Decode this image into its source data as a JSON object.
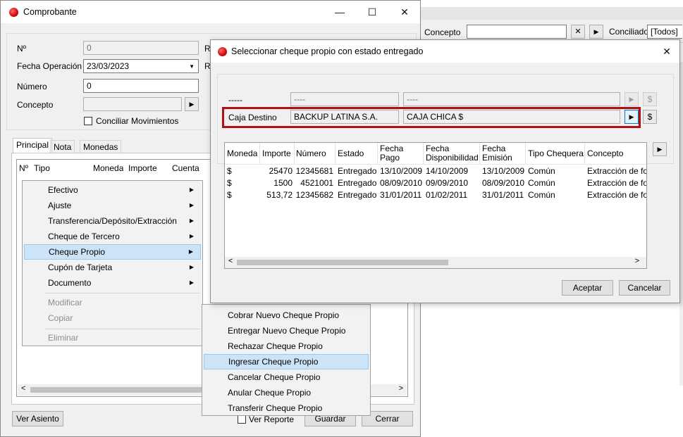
{
  "background_window": {
    "concepto_label": "Concepto",
    "conciliado_label": "Conciliado",
    "conciliado_value": "[Todos]",
    "clear_glyph": "✕",
    "nav_glyph": "▶"
  },
  "comprobante": {
    "title": "Comprobante",
    "controls": {
      "minimize": "—",
      "maximize": "☐",
      "close": "✕"
    },
    "labels": {
      "numero": "Nº",
      "fecha_operacion": "Fecha Operación",
      "numero2": "Número",
      "concepto": "Concepto",
      "conciliar": "Conciliar Movimientos",
      "r1": "R",
      "r2": "R"
    },
    "values": {
      "numero": "0",
      "fecha_operacion": "23/03/2023",
      "numero2": "0",
      "concepto": ""
    },
    "tabs": [
      "Principal",
      "Nota",
      "Monedas"
    ],
    "grid_columns": [
      "Nº",
      "Tipo",
      "Moneda",
      "Importe",
      "Cuenta"
    ],
    "buttons": {
      "ver_asiento": "Ver Asiento",
      "ver_reporte": "Ver Reporte",
      "guardar": "Guardar",
      "cerrar": "Cerrar"
    }
  },
  "context_menu": {
    "items": [
      {
        "label": "Efectivo",
        "arrow": "▶"
      },
      {
        "label": "Ajuste",
        "arrow": "▶"
      },
      {
        "label": "Transferencia/Depósito/Extracción",
        "arrow": "▶"
      },
      {
        "label": "Cheque de Tercero",
        "arrow": "▶"
      },
      {
        "label": "Cheque Propio",
        "arrow": "▶"
      },
      {
        "label": "Cupón de Tarjeta",
        "arrow": "▶"
      },
      {
        "label": "Documento",
        "arrow": "▶"
      }
    ],
    "disabled_items": [
      "Modificar",
      "Copiar",
      "Eliminar"
    ],
    "selected": "Cheque Propio"
  },
  "submenu": {
    "items": [
      "Cobrar Nuevo Cheque Propio",
      "Entregar Nuevo Cheque Propio",
      "Rechazar Cheque Propio",
      "Ingresar Cheque Propio",
      "Cancelar Cheque Propio",
      "Anular Cheque Propio",
      "Transferir Cheque Propio"
    ],
    "selected": "Ingresar Cheque Propio"
  },
  "dialog": {
    "title": "Seleccionar cheque propio con estado entregado",
    "close": "✕",
    "row1": {
      "label": "-----",
      "field1": "----",
      "field2": "----"
    },
    "row2": {
      "label": "Caja Destino",
      "field1": "BACKUP LATINA S.A.",
      "field2": "CAJA CHICA $"
    },
    "dollar": "$",
    "highlight_color": "#b01010",
    "columns": [
      {
        "line1": "Moneda",
        "line2": ""
      },
      {
        "line1": "Importe",
        "line2": ""
      },
      {
        "line1": "Número",
        "line2": ""
      },
      {
        "line1": "Estado",
        "line2": ""
      },
      {
        "line1": "Fecha",
        "line2": "Pago"
      },
      {
        "line1": "Fecha",
        "line2": "Disponibilidad"
      },
      {
        "line1": "Fecha",
        "line2": "Emisión"
      },
      {
        "line1": "Tipo Chequera",
        "line2": ""
      },
      {
        "line1": "Concepto",
        "line2": ""
      }
    ],
    "rows": [
      [
        "$",
        "25470",
        "12345681",
        "Entregado",
        "13/10/2009",
        "14/10/2009",
        "13/10/2009",
        "Común",
        "Extracción de fondos"
      ],
      [
        "$",
        "1500",
        "4521001",
        "Entregado",
        "08/09/2010",
        "09/09/2010",
        "08/09/2010",
        "Común",
        "Extracción de fondos"
      ],
      [
        "$",
        "513,72",
        "12345682",
        "Entregado",
        "31/01/2011",
        "01/02/2011",
        "31/01/2011",
        "Común",
        "Extracción de fondos"
      ]
    ],
    "buttons": {
      "aceptar": "Aceptar",
      "cancelar": "Cancelar"
    },
    "scroll_left": "<",
    "scroll_right": ">"
  }
}
